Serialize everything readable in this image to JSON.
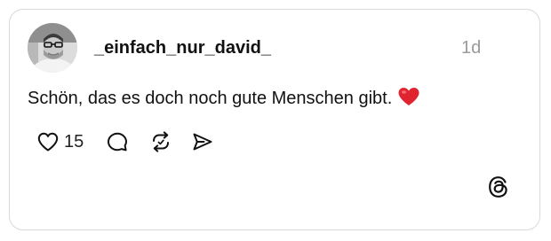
{
  "post": {
    "username": "_einfach_nur_david_",
    "timestamp": "1d",
    "text": "Schön, das es doch noch gute Menschen gibt.",
    "text_emoji": "red-heart-emoji",
    "like_count": "15"
  },
  "icons": {
    "like": "heart-outline-icon",
    "comment": "comment-bubble-icon",
    "repost": "repost-icon",
    "share": "send-icon",
    "brand": "threads-logo-icon"
  },
  "colors": {
    "text": "#111111",
    "muted": "#9a9a9a",
    "border": "#d9d9d9",
    "emoji_heart": "#e0242f"
  }
}
